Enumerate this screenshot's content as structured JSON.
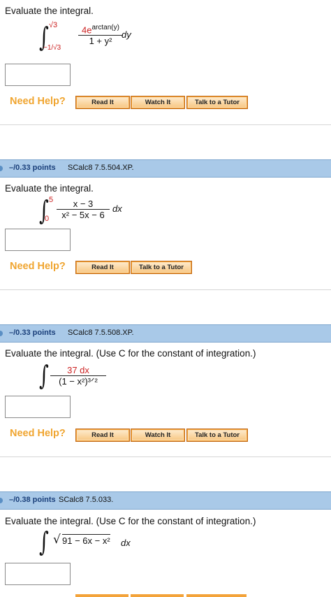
{
  "help": {
    "need_help": "Need Help?",
    "read_it": "Read It",
    "watch_it": "Watch It",
    "talk_to_tutor": "Talk to a Tutor"
  },
  "q1": {
    "prompt": "Evaluate the integral.",
    "upper_limit": "√3",
    "lower_limit": "−1/√3",
    "numerator_base": "4e",
    "numerator_exp": "arctan(y)",
    "denominator": "1 + y²",
    "differential": "dy"
  },
  "q2": {
    "points": "–/0.33 points",
    "code": "SCalc8 7.5.504.XP.",
    "prompt": "Evaluate the integral.",
    "upper_limit": "5",
    "lower_limit": "0",
    "numerator": "x − 3",
    "denominator": "x² − 5x − 6",
    "differential": "dx"
  },
  "q3": {
    "points": "–/0.33 points",
    "code": "SCalc8 7.5.508.XP.",
    "prompt": "Evaluate the integral. (Use C for the constant of integration.)",
    "numerator": "37 dx",
    "denominator": "(1 − x²)³ᐟ²"
  },
  "q4": {
    "points": "–/0.38 points",
    "code": "SCalc8 7.5.033.",
    "prompt": "Evaluate the integral. (Use C for the constant of integration.)",
    "radicand": "91 − 6x − x²",
    "differential": "dx"
  }
}
